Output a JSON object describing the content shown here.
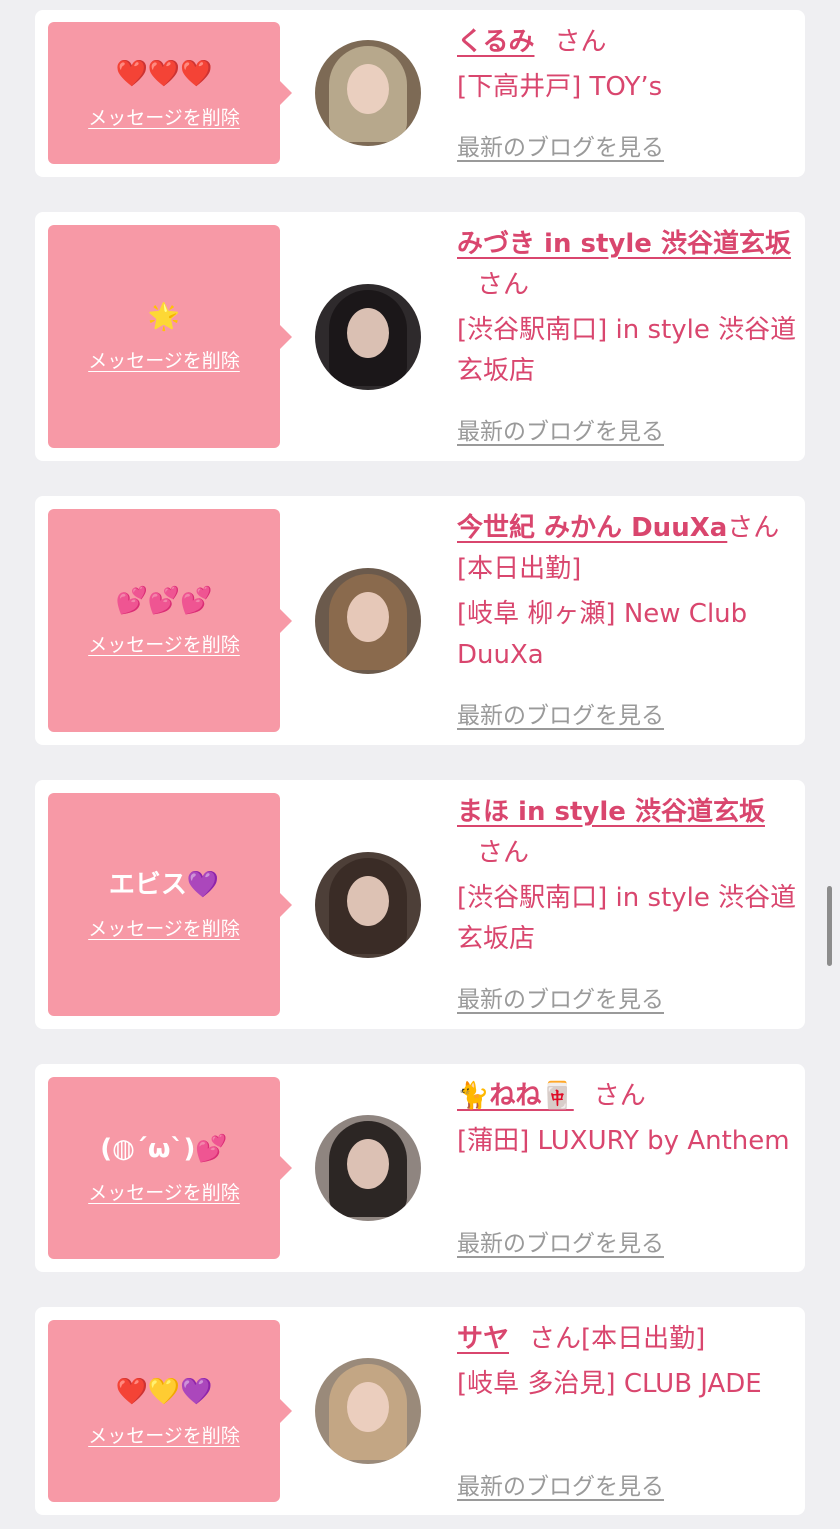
{
  "cards": [
    {
      "message": "❤️❤️❤️",
      "delete_label": "メッセージを削除",
      "name": "くるみ",
      "suffix": "さん",
      "badge": "",
      "shop": "[下高井戸] TOY’s",
      "blog_label": "最新のブログを見る"
    },
    {
      "message": "🌟",
      "delete_label": "メッセージを削除",
      "name": "みづき in style 渋谷道玄坂",
      "suffix": "さん",
      "badge": "",
      "shop": "[渋谷駅南口] in style 渋谷道玄坂店",
      "blog_label": "最新のブログを見る"
    },
    {
      "message": "💕💕💕",
      "delete_label": "メッセージを削除",
      "name": "今世紀 みかん DuuXa",
      "suffix": "さん",
      "badge": "[本日出勤]",
      "shop": "[岐阜 柳ヶ瀬] New Club DuuXa",
      "blog_label": "最新のブログを見る"
    },
    {
      "message": "エビス💜",
      "delete_label": "メッセージを削除",
      "name": "まほ in style 渋谷道玄坂",
      "suffix": "さん",
      "badge": "",
      "shop": "[渋谷駅南口] in style 渋谷道玄坂店",
      "blog_label": "最新のブログを見る"
    },
    {
      "message": "(◍´ω`)💕",
      "delete_label": "メッセージを削除",
      "name": "🐈ねね🀄",
      "suffix": "さん",
      "badge": "",
      "shop": "[蒲田] LUXURY by Anthem",
      "blog_label": "最新のブログを見る"
    },
    {
      "message": "❤️💛💜",
      "delete_label": "メッセージを削除",
      "name": "サヤ",
      "suffix": "さん",
      "badge": "[本日出勤]",
      "shop": "[岐阜 多治見] CLUB JADE",
      "blog_label": "最新のブログを見る"
    }
  ],
  "colors": {
    "bubble": "#f799a6",
    "accent": "#d9466e",
    "blog_link": "#9a9a9a",
    "background": "#efeff2"
  }
}
